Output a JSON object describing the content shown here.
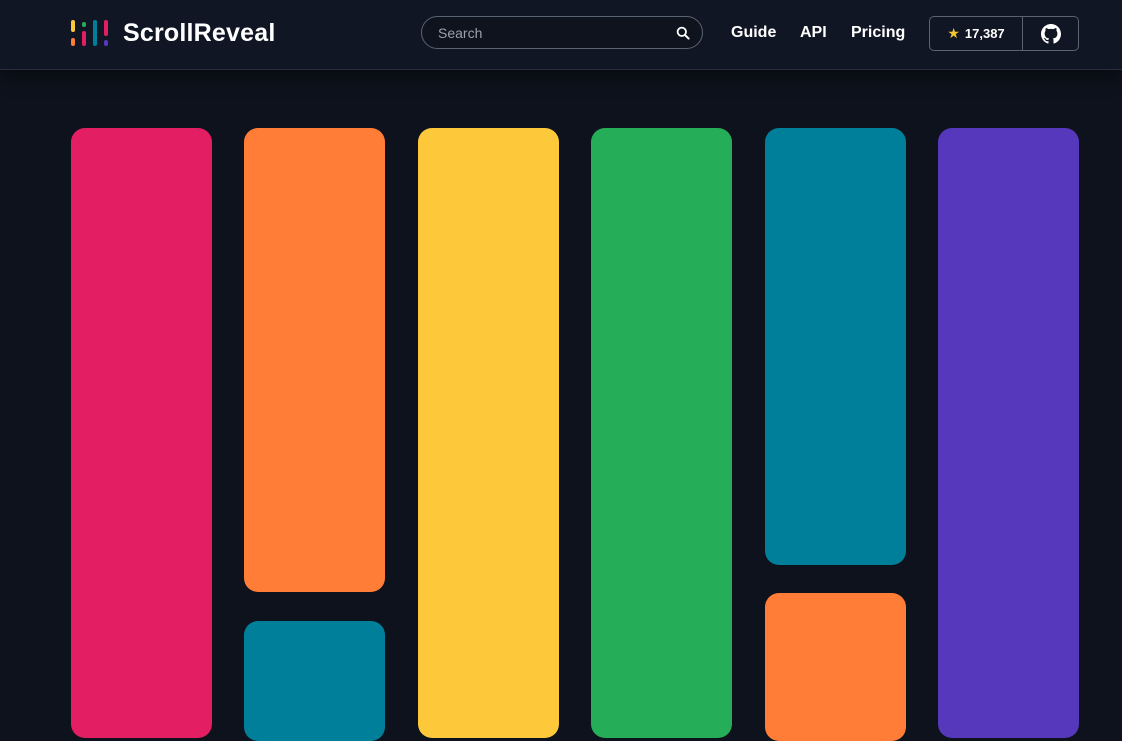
{
  "brand": {
    "name": "ScrollReveal",
    "icon": "scrollreveal-logo-icon",
    "mark_colors": [
      "#fdc93b",
      "#ff7d36",
      "#26ad58",
      "#e41e63",
      "#007f9a",
      "#5538bc"
    ]
  },
  "search": {
    "placeholder": "Search",
    "value": "",
    "icon": "search-icon"
  },
  "nav": {
    "links": [
      "Guide",
      "API",
      "Pricing"
    ]
  },
  "github": {
    "star_icon": "star-icon",
    "stars": "17,387",
    "icon": "github-icon"
  },
  "colors": {
    "background": "#0e121c",
    "navbar": "#101623",
    "pink": "#e41e63",
    "orange": "#ff7d36",
    "yellow": "#fdc93b",
    "green": "#26ad58",
    "teal": "#007f9a",
    "purple": "#5538bc"
  }
}
